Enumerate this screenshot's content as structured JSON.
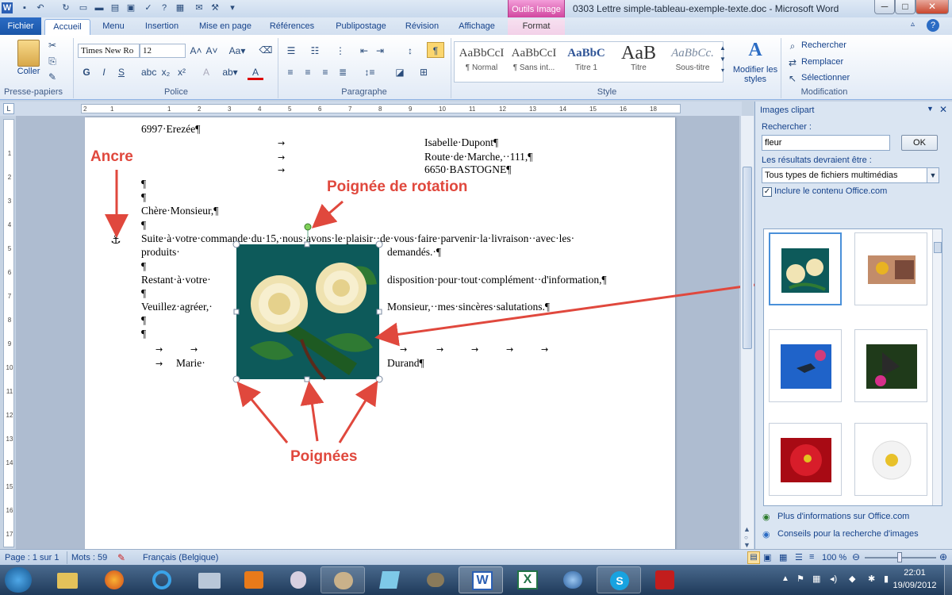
{
  "window": {
    "title": "0303 Lettre simple-tableau-exemple-texte.doc - Microsoft Word",
    "contextual_group": "Outils Image",
    "minimize": "─",
    "maximize": "□",
    "close": "✕"
  },
  "tabs": [
    "Fichier",
    "Accueil",
    "Menu",
    "Insertion",
    "Mise en page",
    "Références",
    "Publipostage",
    "Révision",
    "Affichage",
    "Format"
  ],
  "ribbon": {
    "clipboard": {
      "paste_label": "Coller",
      "group": "Presse-papiers"
    },
    "font": {
      "name": "Times New Ro",
      "size": "12",
      "group": "Police",
      "bold": "G",
      "italic": "I",
      "underline": "S"
    },
    "paragraph": {
      "group": "Paragraphe",
      "pilcrow": "¶"
    },
    "styles": {
      "group": "Style",
      "items": [
        {
          "sample": "AaBbCcI",
          "name": "¶ Normal"
        },
        {
          "sample": "AaBbCcI",
          "name": "¶ Sans int..."
        },
        {
          "sample": "AaBbC",
          "name": "Titre 1"
        },
        {
          "sample": "AaB",
          "name": "Titre"
        },
        {
          "sample": "AaBbCc.",
          "name": "Sous-titre"
        }
      ],
      "modify_label": "Modifier les styles"
    },
    "editing": {
      "group": "Modification",
      "find": "Rechercher",
      "replace": "Remplacer",
      "select": "Sélectionner"
    }
  },
  "ruler": {
    "ticks": [
      "2",
      "1",
      "1",
      "2",
      "3",
      "4",
      "5",
      "6",
      "7",
      "8",
      "9",
      "10",
      "11",
      "12",
      "13",
      "14",
      "15",
      "16",
      "18"
    ]
  },
  "vruler": {
    "ticks": [
      "1",
      "2",
      "3",
      "4",
      "5",
      "6",
      "7",
      "8",
      "9",
      "10",
      "11",
      "12",
      "13",
      "14",
      "15",
      "16",
      "17"
    ]
  },
  "document": {
    "lines": [
      {
        "text": "6997·Erezée¶"
      },
      {
        "text": "Isabelle·Dupont¶"
      },
      {
        "text": "Route·de·Marche,··111,¶"
      },
      {
        "text": "6650·BASTOGNE¶"
      },
      {
        "text": "¶"
      },
      {
        "text": "¶"
      },
      {
        "text": "Chère·Monsieur,¶"
      },
      {
        "text": "¶"
      },
      {
        "text": "Suite·à·votre·commande·du·15,·nous·avons·le·plaisir··de·vous·faire·parvenir·la·livraison··avec·les·"
      },
      {
        "text": "produits·"
      },
      {
        "text": "demandés.·¶"
      },
      {
        "text": "¶"
      },
      {
        "text": "Restant·à·votre·"
      },
      {
        "text": "disposition·pour·tout·complément··d'information,¶"
      },
      {
        "text": "¶"
      },
      {
        "text": "Veuillez·agréer,·"
      },
      {
        "text": "Monsieur,··mes·sincères·salutations.¶"
      },
      {
        "text": "¶"
      },
      {
        "text": "¶"
      },
      {
        "text": "Marie·"
      },
      {
        "text": "Durand¶"
      }
    ],
    "tab_arrow": "→"
  },
  "annotations": {
    "anchor": "Ancre",
    "rotation": "Poignée de rotation",
    "handles": "Poignées"
  },
  "clipart_pane": {
    "title": "Images clipart",
    "search_label": "Rechercher :",
    "search_value": "fleur",
    "ok": "OK",
    "results_label": "Les résultats devraient être :",
    "results_value": "Tous types de fichiers multimédias",
    "include_label": "Inclure le contenu Office.com",
    "include_checked": true,
    "link_more": "Plus d'informations sur Office.com",
    "link_tips": "Conseils pour la recherche d'images"
  },
  "status": {
    "page": "Page : 1 sur 1",
    "words": "Mots : 59",
    "language": "Français (Belgique)",
    "zoom": "100 %"
  },
  "taskbar": {
    "time": "22:01",
    "date": "19/09/2012"
  },
  "colors": {
    "annotation": "#e0483d",
    "accent_file_tab": "#1a56a8",
    "contextual": "#d1469f"
  }
}
